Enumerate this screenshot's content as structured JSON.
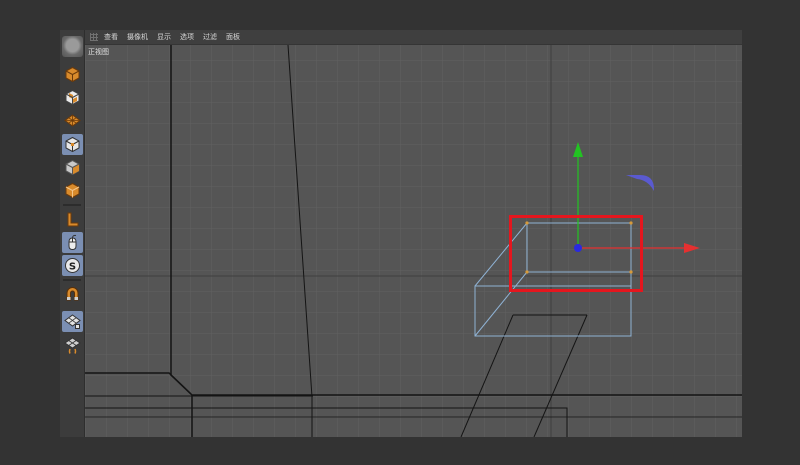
{
  "menu": {
    "items": [
      "查看",
      "摄像机",
      "显示",
      "选项",
      "过滤",
      "面板"
    ]
  },
  "viewport": {
    "label": "正视图"
  },
  "toolbar": {
    "tools": [
      {
        "name": "view-cube-icon",
        "active": false
      },
      {
        "name": "object-checker-icon",
        "active": false
      },
      {
        "name": "polygon-grid-icon",
        "active": false
      },
      {
        "name": "active-cube-icon",
        "active": true
      },
      {
        "name": "points-cube-icon",
        "active": false
      },
      {
        "name": "edge-cube-icon",
        "active": false
      },
      {
        "name": "axis-l-icon",
        "active": false
      },
      {
        "name": "mouse-icon",
        "active": true
      },
      {
        "name": "snap-s-icon",
        "active": true
      },
      {
        "name": "magnet-icon",
        "active": false
      },
      {
        "name": "lock-grid-icon",
        "active": true
      },
      {
        "name": "workplane-grid-icon",
        "active": false
      }
    ]
  },
  "colors": {
    "background": "#333333",
    "viewport": "#555555",
    "grid": "#606060",
    "selection_box": "#e5161e",
    "axis_x": "#e53030",
    "axis_y": "#22c322",
    "axis_center": "#2a2ae0",
    "wireframe": "#8fb2d4",
    "active_tool": "#7b8fb3"
  }
}
